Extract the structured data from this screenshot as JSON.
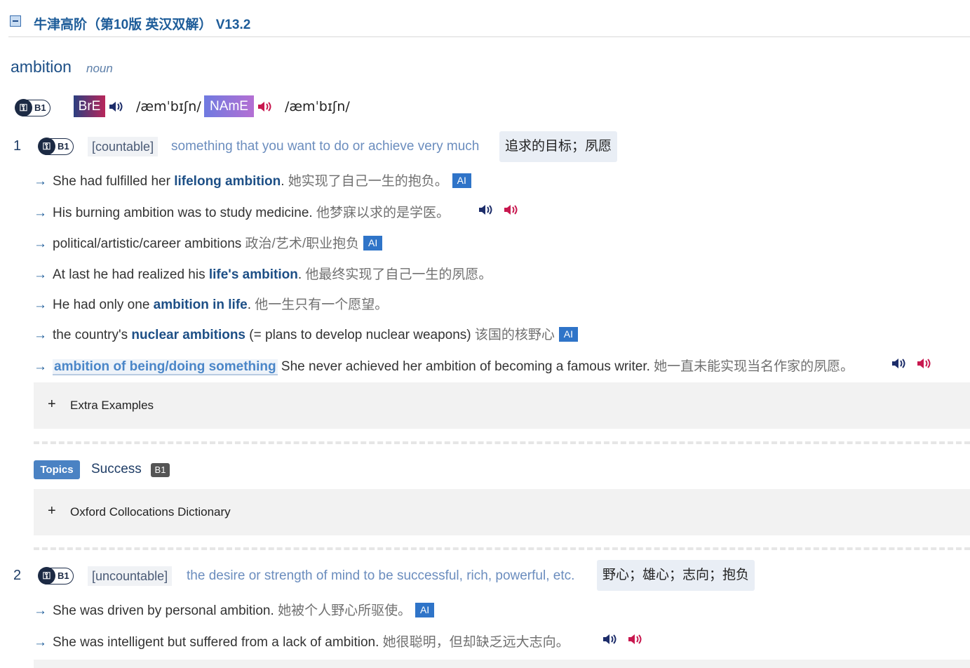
{
  "header": {
    "title": "牛津高阶（第10版 英汉双解） V13.2"
  },
  "entry": {
    "headword": "ambition",
    "pos": "noun",
    "level": "B1",
    "pron": {
      "bre_label": "BrE",
      "bre_ipa": "/æmˈbɪʃn/",
      "name_label": "NAmE",
      "name_ipa": "/æmˈbɪʃn/"
    }
  },
  "senses": [
    {
      "num": "1",
      "level": "B1",
      "grammar": "[countable]",
      "definition": "something that you want to do or achieve very much",
      "definition_cn": "追求的目标；夙愿",
      "examples": [
        {
          "pre": "She had fulfilled her ",
          "bold": "lifelong ambition",
          "post": ".",
          "cn": " 她实现了自己一生的抱负。",
          "ai": "AI"
        },
        {
          "pre": "His burning ambition was to study medicine.",
          "cn": " 他梦寐以求的是学医。"
        },
        {
          "pre": "political/artistic/career ambitions",
          "cn": " 政治/艺术/职业抱负",
          "ai": "AI"
        },
        {
          "pre": "At last he had realized his ",
          "bold": "life's ambition",
          "post": ".",
          "cn": " 他最终实现了自己一生的夙愿。"
        },
        {
          "pre": "He had only one ",
          "bold": "ambition in life",
          "post": ".",
          "cn": " 他一生只有一个愿望。"
        },
        {
          "pre": "the country's ",
          "bold": "nuclear ambitions",
          "post": " (= plans to develop nuclear weapons)",
          "cn": " 该国的核野心",
          "ai": "AI"
        },
        {
          "pattern": "ambition of being/doing something",
          "pre": " She never achieved her ambition of becoming a famous writer.",
          "cn": " 她一直未能实现当名作家的夙愿。"
        }
      ],
      "extra_examples_label": "Extra Examples",
      "topics": {
        "tag": "Topics",
        "name": "Success",
        "level": "B1"
      },
      "collocations_label": "Oxford Collocations Dictionary"
    },
    {
      "num": "2",
      "level": "B1",
      "grammar": "[uncountable]",
      "definition": "the desire or strength of mind to be successful, rich, powerful, etc.",
      "definition_cn": "野心；雄心；志向；抱负",
      "examples": [
        {
          "pre": "She was driven by personal ambition.",
          "cn": " 她被个人野心所驱使。",
          "ai": "AI"
        },
        {
          "pre": "She was intelligent but suffered from a lack of ambition.",
          "cn": " 她很聪明，但却缺乏远大志向。"
        }
      ]
    }
  ],
  "colors": {
    "accent": "#1d5c99",
    "bre_speaker": "#1d2d6a",
    "name_speaker": "#c8184f",
    "ai_badge": "#2f74c8"
  },
  "icons": {
    "arrow": "→",
    "plus": "+",
    "key": "key-icon",
    "speaker": "speaker-icon"
  }
}
